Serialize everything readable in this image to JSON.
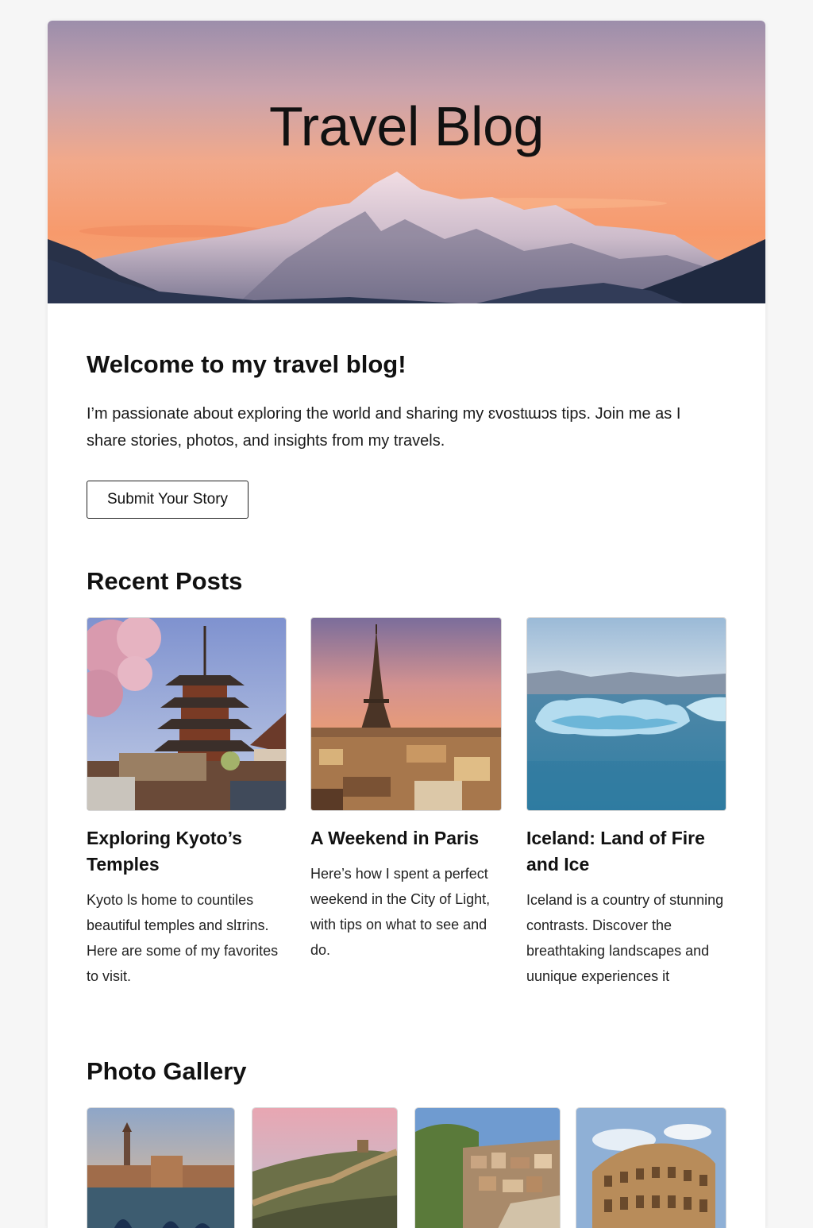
{
  "hero": {
    "title": "Travel Blog",
    "image": "mountain-sunset-photo"
  },
  "welcome": {
    "heading": "Welcome to my travel blog!",
    "intro": "I’m passionate about exploring the world and sharing my ɛvostɩɯɔs tips. Join me as I share stories, photos, and insights from my travels.",
    "button_label": "Submit Your Story"
  },
  "recent_posts": {
    "heading": "Recent Posts",
    "posts": [
      {
        "title": "Exploring Kyoto’s Temples",
        "excerpt": "Kyoto ls home to countiles beautiful temples and slɪrins. Here are some of my favorites to visit.",
        "image": "kyoto-pagoda-photo"
      },
      {
        "title": "A Weekend in Paris",
        "excerpt": "Here’s how I spent a perfect weekend in the City of Light, with tips on what to see and do.",
        "image": "eiffel-tower-photo"
      },
      {
        "title": "Iceland: Land of Fire and Ice",
        "excerpt": "Iceland is a country of stunning contrasts. Discover the breathtaking landscapes and uunique experiences it",
        "image": "iceland-glacier-photo"
      }
    ]
  },
  "gallery": {
    "heading": "Photo Gallery",
    "photos": [
      "venice-photo",
      "great-wall-photo",
      "cliff-town-photo",
      "colosseum-photo"
    ]
  },
  "colors": {
    "page_background": "#f6f6f6",
    "card_background": "#ffffff",
    "text": "#111111",
    "sunset_orange": "#f59a6a",
    "dusk_purple": "#9a8aa8"
  }
}
